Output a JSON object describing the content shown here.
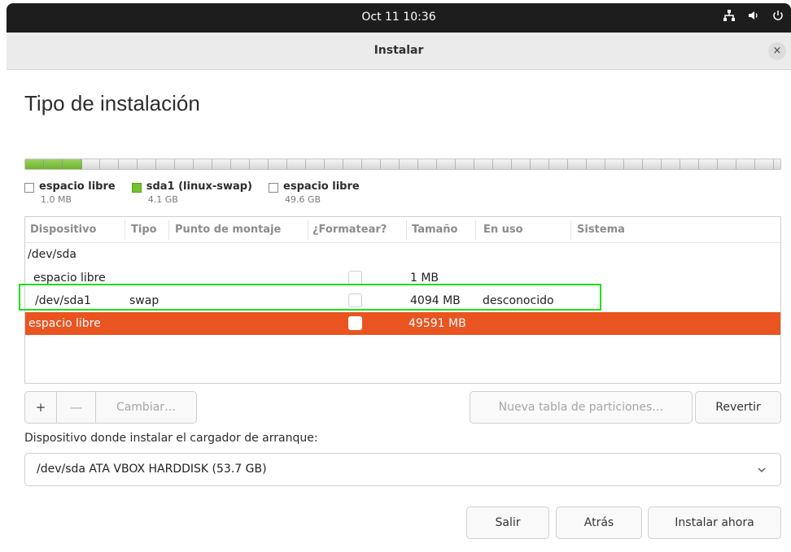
{
  "topbar": {
    "clock": "Oct 11  10:36"
  },
  "window": {
    "title": "Instalar",
    "close_label": "×"
  },
  "page": {
    "title": "Tipo de instalación"
  },
  "partition_bar": {
    "swap_fraction": 0.075
  },
  "legend": [
    {
      "name": "espacio libre",
      "size": "1.0 MB",
      "color": "#ffffff"
    },
    {
      "name": "sda1 (linux-swap)",
      "size": "4.1 GB",
      "color": "#73c12e"
    },
    {
      "name": "espacio libre",
      "size": "49.6 GB",
      "color": "#ffffff"
    }
  ],
  "table": {
    "columns": [
      "Dispositivo",
      "Tipo",
      "Punto de montaje",
      "¿Formatear?",
      "Tamaño",
      "En uso",
      "Sistema"
    ],
    "rows": [
      {
        "device": "/dev/sda",
        "type": "",
        "mount": "",
        "format": null,
        "size": "",
        "used": "",
        "system": ""
      },
      {
        "device": "espacio libre",
        "type": "",
        "mount": "",
        "format": false,
        "size": "1 MB",
        "used": "",
        "system": ""
      },
      {
        "device": "/dev/sda1",
        "type": "swap",
        "mount": "",
        "format": false,
        "size": "4094 MB",
        "used": "desconocido",
        "system": ""
      },
      {
        "device": "espacio libre",
        "type": "",
        "mount": "",
        "format": false,
        "size": "49591 MB",
        "used": "",
        "system": "",
        "selected": true
      }
    ]
  },
  "actions": {
    "add": "+",
    "remove": "—",
    "change": "Cambiar…",
    "new_table": "Nueva tabla de particiones…",
    "revert": "Revertir"
  },
  "bootloader": {
    "label": "Dispositivo donde instalar el cargador de arranque:",
    "value": "/dev/sda ATA VBOX HARDDISK (53.7 GB)"
  },
  "footer": {
    "quit": "Salir",
    "back": "Atrás",
    "install": "Instalar ahora"
  },
  "colors": {
    "accent": "#e95420",
    "swap_green": "#73c12e",
    "highlight": "#1ddf1d"
  }
}
